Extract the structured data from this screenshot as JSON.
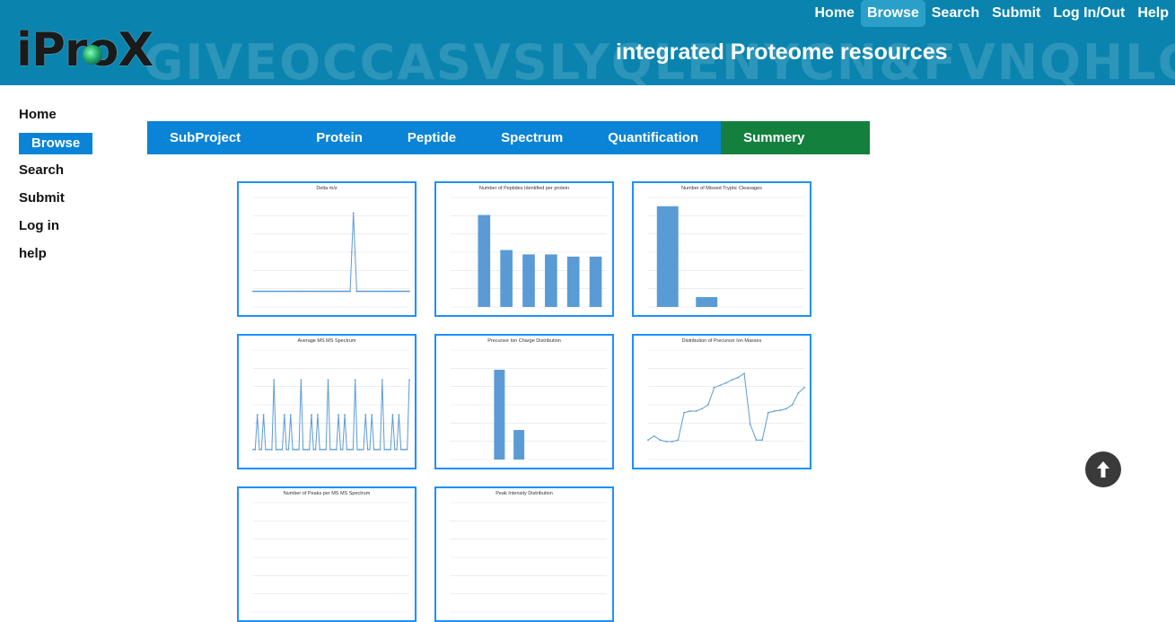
{
  "header": {
    "watermark": "GIVEOCCASVSLYQLENYCN&FVNQHLC",
    "logo_text": "iProX",
    "site_title": "integrated Proteome resources",
    "nav": [
      {
        "label": "Home"
      },
      {
        "label": "Browse",
        "active": true
      },
      {
        "label": "Search"
      },
      {
        "label": "Submit"
      },
      {
        "label": "Log In/Out"
      },
      {
        "label": "Help"
      }
    ]
  },
  "sidebar": {
    "items": [
      {
        "label": "Home"
      },
      {
        "label": "Browse",
        "active": true
      },
      {
        "label": "Search"
      },
      {
        "label": "Submit"
      },
      {
        "label": "Log in"
      },
      {
        "label": "help"
      }
    ]
  },
  "tabs": [
    {
      "label": "SubProject View"
    },
    {
      "label": "Protein"
    },
    {
      "label": "Peptide"
    },
    {
      "label": "Spectrum"
    },
    {
      "label": "Quantification"
    },
    {
      "label": "Summery Charts",
      "active": true
    }
  ],
  "colors": {
    "header": "#0a84ae",
    "tab_bar": "#0a84d6",
    "tab_active": "#13803e",
    "chart_line": "#5b9bd5"
  },
  "charts": [
    {
      "title": "Delta m/z",
      "type": "line",
      "values": [
        0,
        0,
        0,
        0,
        0,
        0,
        0,
        0,
        0,
        0,
        0,
        0,
        0,
        0,
        0,
        0,
        0,
        0,
        0,
        0,
        0,
        0,
        0,
        0,
        0,
        0,
        0,
        0,
        0,
        0,
        0,
        0,
        0,
        0,
        0,
        0,
        0,
        0,
        0,
        0,
        0,
        0,
        0,
        0,
        0,
        0,
        0,
        0,
        0,
        0,
        0,
        0,
        0,
        0,
        0,
        0,
        0,
        0,
        0,
        0,
        0.5,
        1,
        0.5,
        0,
        0,
        0,
        0,
        0,
        0,
        0,
        0,
        0,
        0,
        0,
        0,
        0,
        0,
        0,
        0,
        0,
        0,
        0,
        0,
        0,
        0,
        0,
        0,
        0,
        0,
        0,
        0,
        0,
        0,
        0,
        0,
        0
      ],
      "ylim": [
        -0.2,
        1.2
      ]
    },
    {
      "title": "Number of Peptides Identified per protein",
      "type": "bar",
      "values": [
        0,
        42,
        26,
        24,
        24,
        23,
        23
      ],
      "ylim": [
        0,
        50
      ]
    },
    {
      "title": "Number of Missed Tryptic Cleavages",
      "type": "bar",
      "values": [
        92,
        9,
        0,
        0
      ],
      "ylim": [
        0,
        100
      ]
    },
    {
      "title": "Average MS MS Spectrum",
      "type": "line",
      "values": [
        0,
        0,
        35,
        0,
        0,
        35,
        0,
        0,
        0,
        0,
        70,
        0,
        0,
        0,
        0,
        35,
        0,
        0,
        35,
        0,
        0,
        0,
        0,
        70,
        0,
        0,
        0,
        0,
        35,
        0,
        0,
        35,
        0,
        0,
        0,
        0,
        70,
        0,
        0,
        0,
        0,
        35,
        0,
        0,
        35,
        0,
        0,
        0,
        0,
        70,
        0,
        0,
        0,
        0,
        35,
        0,
        0,
        35,
        0,
        0,
        0,
        0,
        70,
        0,
        0,
        0,
        0,
        35,
        0,
        0,
        35,
        0,
        0,
        0,
        0,
        70
      ],
      "ylim": [
        -10,
        100
      ]
    },
    {
      "title": "Precursor Ion Charge Distribution",
      "type": "bar",
      "values": [
        0,
        0,
        82,
        27,
        0,
        0,
        0,
        0
      ],
      "ylim": [
        0,
        100
      ]
    },
    {
      "title": "Distribution of Precursor Ion Masses",
      "type": "line",
      "values": [
        0.05,
        0.1,
        0.05,
        0.03,
        0.03,
        0.05,
        0.4,
        0.42,
        0.42,
        0.45,
        0.5,
        0.72,
        0.75,
        0.78,
        0.82,
        0.85,
        0.9,
        0.25,
        0.05,
        0.05,
        0.4,
        0.42,
        0.43,
        0.45,
        0.5,
        0.65,
        0.72
      ],
      "ylim": [
        -0.2,
        1.2
      ]
    },
    {
      "title": "Number of Peaks per MS MS Spectrum",
      "type": "bar",
      "values": [],
      "ylim": [
        0,
        100
      ]
    },
    {
      "title": "Peak Intensity Distribution",
      "type": "bar",
      "values": [],
      "ylim": [
        0,
        100
      ]
    }
  ]
}
